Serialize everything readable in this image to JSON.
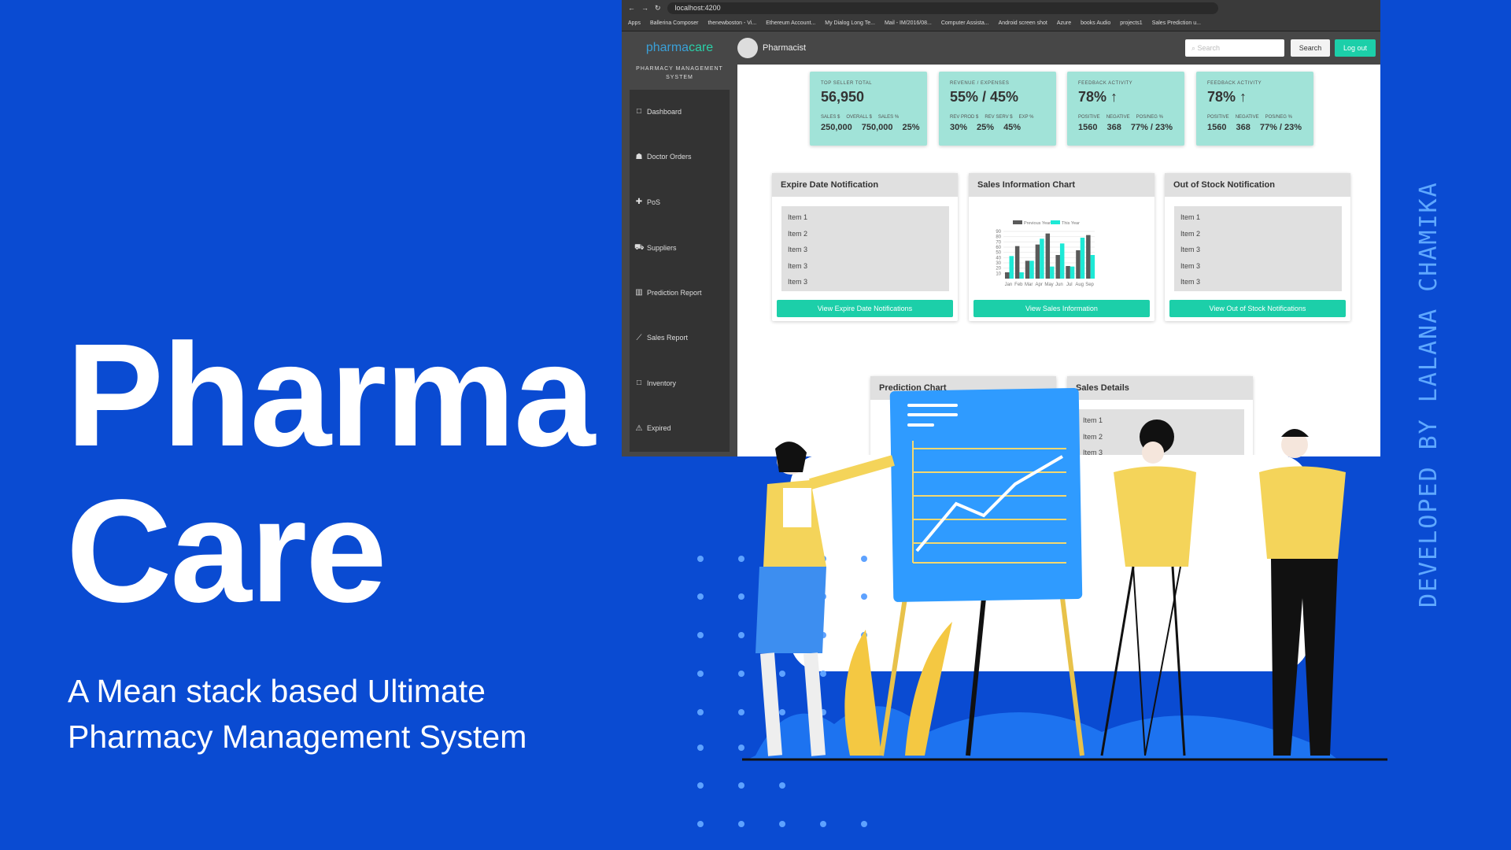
{
  "hero": {
    "title_line1": "Pharma",
    "title_line2": "Care",
    "subtitle_line1": "A Mean stack based Ultimate",
    "subtitle_line2": "Pharmacy Management System",
    "credit": "DEVELOPED BY LALANA CHAMIKA"
  },
  "browser": {
    "url": "localhost:4200",
    "bookmarks": [
      "Apps",
      "Ballerina Composer",
      "thenewboston - Vi...",
      "Ethereum Account...",
      "My Dialog Long Te...",
      "Mail - IM/2016/08...",
      "Computer Assista...",
      "Android screen shot",
      "Azure",
      "books Audio",
      "projects1",
      "Sales Prediction u..."
    ]
  },
  "app": {
    "logo_a": "pharma",
    "logo_b": "care",
    "subtitle": "PHARMACY MANAGEMENT SYSTEM",
    "role": "Pharmacist",
    "search_placeholder": "Search",
    "search_button": "Search",
    "logout_button": "Log out",
    "nav": [
      {
        "label": "Dashboard",
        "icon": "□"
      },
      {
        "label": "Doctor Orders",
        "icon": "☗"
      },
      {
        "label": "PoS",
        "icon": "✚"
      },
      {
        "label": "Suppliers",
        "icon": "⛟"
      },
      {
        "label": "Prediction Report",
        "icon": "▥"
      },
      {
        "label": "Sales Report",
        "icon": "⟋"
      },
      {
        "label": "Inventory",
        "icon": "□"
      },
      {
        "label": "Expired",
        "icon": "⚠"
      }
    ],
    "cards": [
      {
        "label": "TOP SELLER TOTAL",
        "value": "56,950",
        "sublabels": [
          "SALES $",
          "OVERALL $",
          "SALES %"
        ],
        "subvalues": [
          "250,000",
          "750,000",
          "25%"
        ]
      },
      {
        "label": "REVENUE / EXPENSES",
        "value": "55% / 45%",
        "sublabels": [
          "REV PROD $",
          "REV SERV $",
          "EXP %"
        ],
        "subvalues": [
          "30%",
          "25%",
          "45%"
        ]
      },
      {
        "label": "FEEDBACK ACTIVITY",
        "value": "78% ↑",
        "sublabels": [
          "POSITIVE",
          "NEGATIVE",
          "POS/NEG %"
        ],
        "subvalues": [
          "1560",
          "368",
          "77% / 23%"
        ]
      },
      {
        "label": "FEEDBACK ACTIVITY",
        "value": "78% ↑",
        "sublabels": [
          "POSITIVE",
          "NEGATIVE",
          "POS/NEG %"
        ],
        "subvalues": [
          "1560",
          "368",
          "77% / 23%"
        ]
      }
    ],
    "panels": [
      {
        "title": "Expire Date Notification",
        "items": [
          "Item 1",
          "Item 2",
          "Item 3",
          "Item 3",
          "Item 3"
        ],
        "button": "View Expire Date Notifications"
      },
      {
        "title": "Sales Information Chart",
        "button": "View Sales Information"
      },
      {
        "title": "Out of Stock Notification",
        "items": [
          "Item 1",
          "Item 2",
          "Item 3",
          "Item 3",
          "Item 3"
        ],
        "button": "View Out of Stock Notifications"
      },
      {
        "title": "Prediction Chart"
      },
      {
        "title": "Sales Details",
        "items": [
          "Item 1",
          "Item 2",
          "Item 3"
        ]
      }
    ]
  },
  "colors": {
    "background": "#0a4bd2",
    "accent": "#1ccfa9",
    "card": "#a1e3d8",
    "prev_year": "#5a5a5a",
    "this_year": "#1de9d6"
  },
  "chart_data": {
    "type": "bar",
    "categories": [
      "Jan",
      "Feb",
      "Mar",
      "Apr",
      "May",
      "Jun",
      "Jul",
      "Aug",
      "Sep"
    ],
    "series": [
      {
        "name": "Previous Year",
        "values": [
          12,
          62,
          34,
          65,
          86,
          45,
          24,
          54,
          83
        ]
      },
      {
        "name": "This Year",
        "values": [
          43,
          12,
          34,
          76,
          23,
          67,
          23,
          78,
          45
        ]
      }
    ],
    "ylim": [
      0,
      90
    ],
    "yticks": [
      10,
      20,
      30,
      40,
      50,
      60,
      70,
      80,
      90
    ],
    "legend": "top",
    "grid": true
  }
}
